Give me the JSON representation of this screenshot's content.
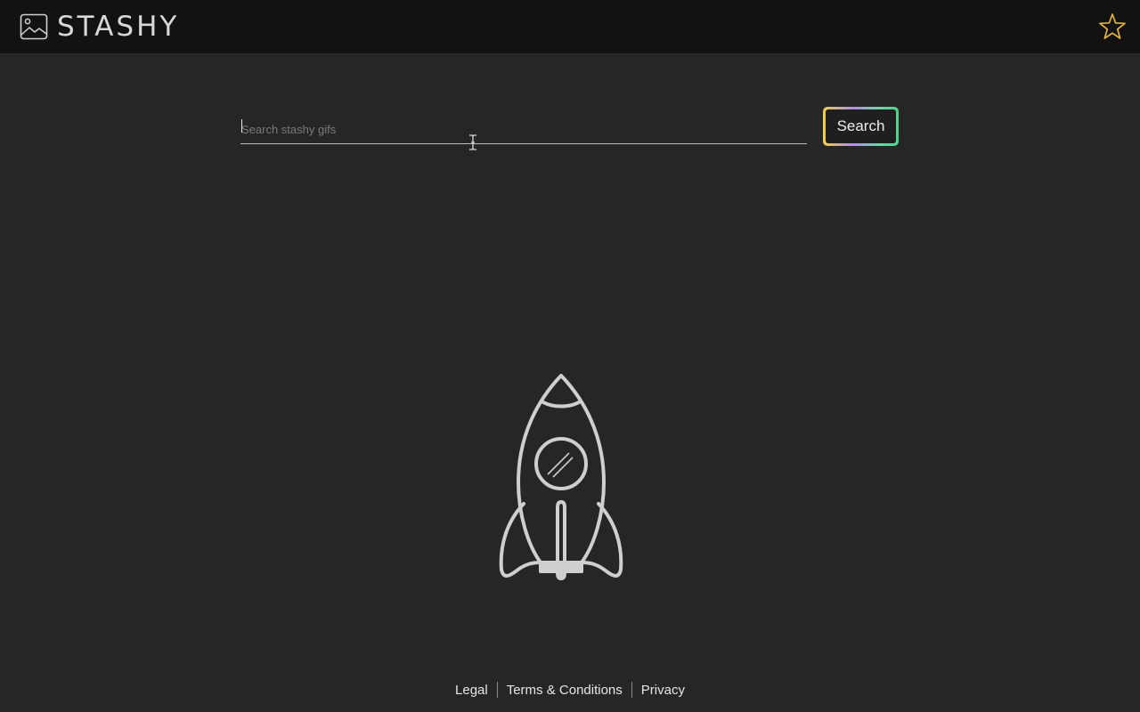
{
  "app": {
    "brand_name": "STASHY"
  },
  "header": {
    "logo_icon": "image-icon",
    "favorites_icon": "star-icon",
    "accent_color": "#e3b341"
  },
  "search": {
    "placeholder": "Search stashy gifs",
    "value": "",
    "button_label": "Search"
  },
  "illustration": {
    "icon": "rocket-icon"
  },
  "footer": {
    "links": [
      "Legal",
      "Terms & Conditions",
      "Privacy"
    ]
  },
  "colors": {
    "background": "#262626",
    "header_bg": "#121212",
    "button_gradient": [
      "#f2cf4a",
      "#b08ee6",
      "#49d38d"
    ]
  }
}
